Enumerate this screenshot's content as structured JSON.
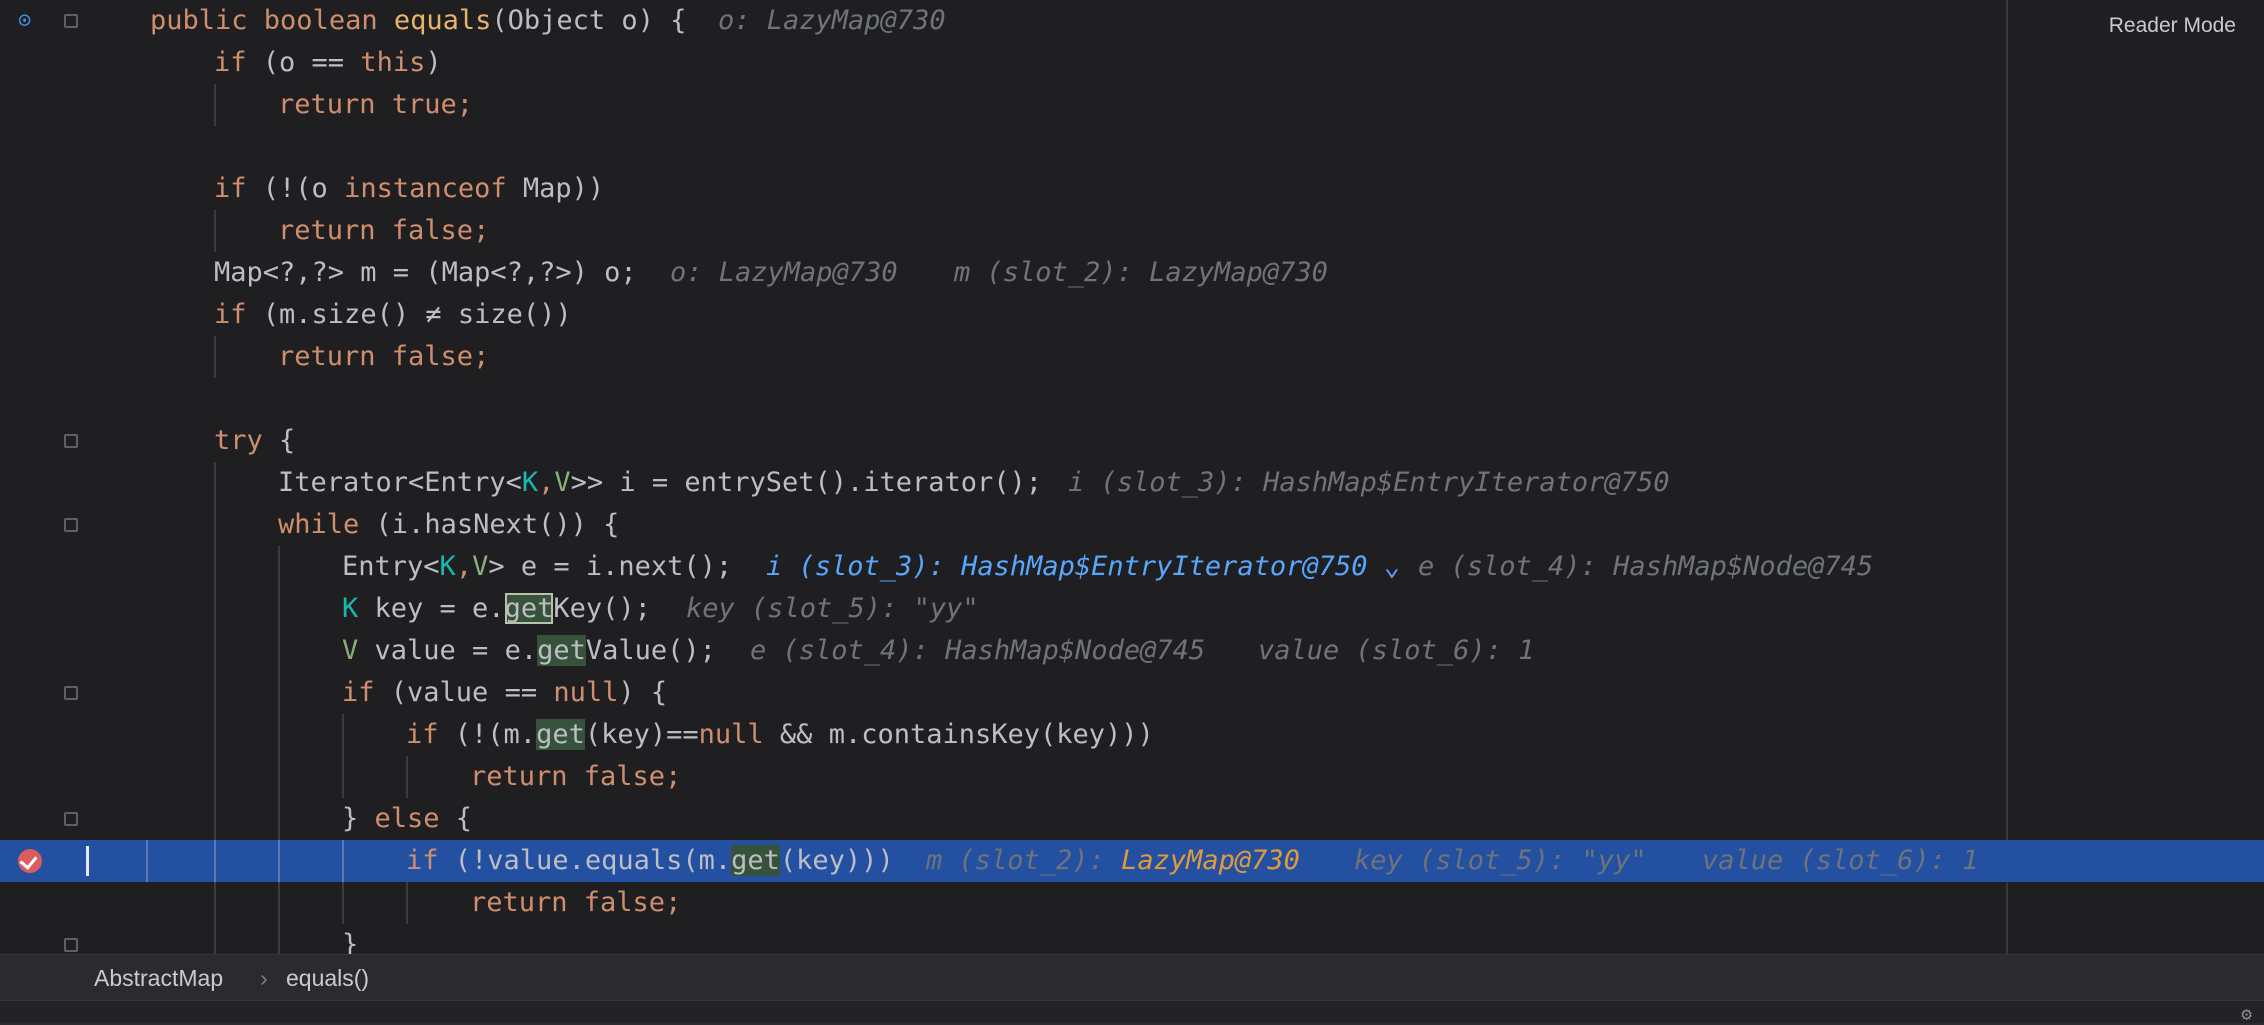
{
  "editor": {
    "reader_mode": "Reader Mode",
    "lines": {
      "l0": {
        "a": "public ",
        "b": "boolean ",
        "c": "equals",
        "d": "(Object o) {",
        "hint": "o: LazyMap@730"
      },
      "l1": {
        "a": "if ",
        "b": "(o == ",
        "c": "this",
        "d": ")"
      },
      "l2": {
        "a": "return true;"
      },
      "l4": {
        "a": "if ",
        "b": "(!(o ",
        "c": "instanceof ",
        "d": "Map))"
      },
      "l5": {
        "a": "return false;"
      },
      "l6": {
        "a": "Map<?,?> m = (Map<?,?>) o;",
        "hint1": "o: LazyMap@730",
        "hint2": "m (slot_2): LazyMap@730"
      },
      "l7": {
        "a": "if ",
        "b": "(m.size() ≠ size())"
      },
      "l8": {
        "a": "return false;"
      },
      "l10": {
        "a": "try ",
        "b": "{"
      },
      "l11": {
        "a": "Iterator<Entry<",
        "k": "K",
        "comma": ",",
        "v": "V",
        "b": ">> i = entrySet().iterator();",
        "hint": "i (slot_3): HashMap$EntryIterator@750"
      },
      "l12": {
        "a": "while ",
        "b": "(i.hasNext()) {"
      },
      "l13": {
        "a": "Entry<",
        "k": "K",
        "comma": ",",
        "v": "V",
        "b": "> e = i.next();",
        "hint1": "i (slot_3): HashMap$EntryIterator@750",
        "chev": "⌄",
        "hint2": "e (slot_4): HashMap$Node@745"
      },
      "l14": {
        "k": "K",
        "a": " key = e.",
        "g": "get",
        "b": "Key();",
        "hint": "key (slot_5): \"yy\""
      },
      "l15": {
        "v": "V",
        "a": " value = e.",
        "g": "get",
        "b": "Value();",
        "hint1": "e (slot_4): HashMap$Node@745",
        "hint2": "value (slot_6): 1"
      },
      "l16": {
        "a": "if ",
        "b": "(value == ",
        "n": "null",
        "c": ") {"
      },
      "l17": {
        "a": "if ",
        "b": "(!(m.",
        "g": "get",
        "c": "(key)==",
        "n": "null",
        "d": " && m.containsKey(key)))"
      },
      "l18": {
        "a": "return false;"
      },
      "l19": {
        "a": "} ",
        "b": "else ",
        "c": "{"
      },
      "l20": {
        "a": "if ",
        "b": "(!value.equals(m.",
        "g": "get",
        "c": "(key)))",
        "hk1": "m (slot_2): ",
        "hv1": "LazyMap@730",
        "hint2": "key (slot_5): \"yy\"",
        "hint3": "value (slot_6): 1"
      },
      "l21": {
        "a": "return false;"
      },
      "l22": {
        "a": "}"
      }
    }
  },
  "breadcrumb": {
    "class_name": "AbstractMap",
    "separator": "›",
    "method": "equals()"
  },
  "icons": {
    "breakpoint": "breakpoint-check-icon",
    "debug": "debug-step-icon",
    "settings": "gear-icon"
  },
  "colors": {
    "current_line": "#2350a0",
    "breakpoint": "#db5c5c",
    "keyword": "#cf8e6d",
    "hint": "#6f737a"
  }
}
